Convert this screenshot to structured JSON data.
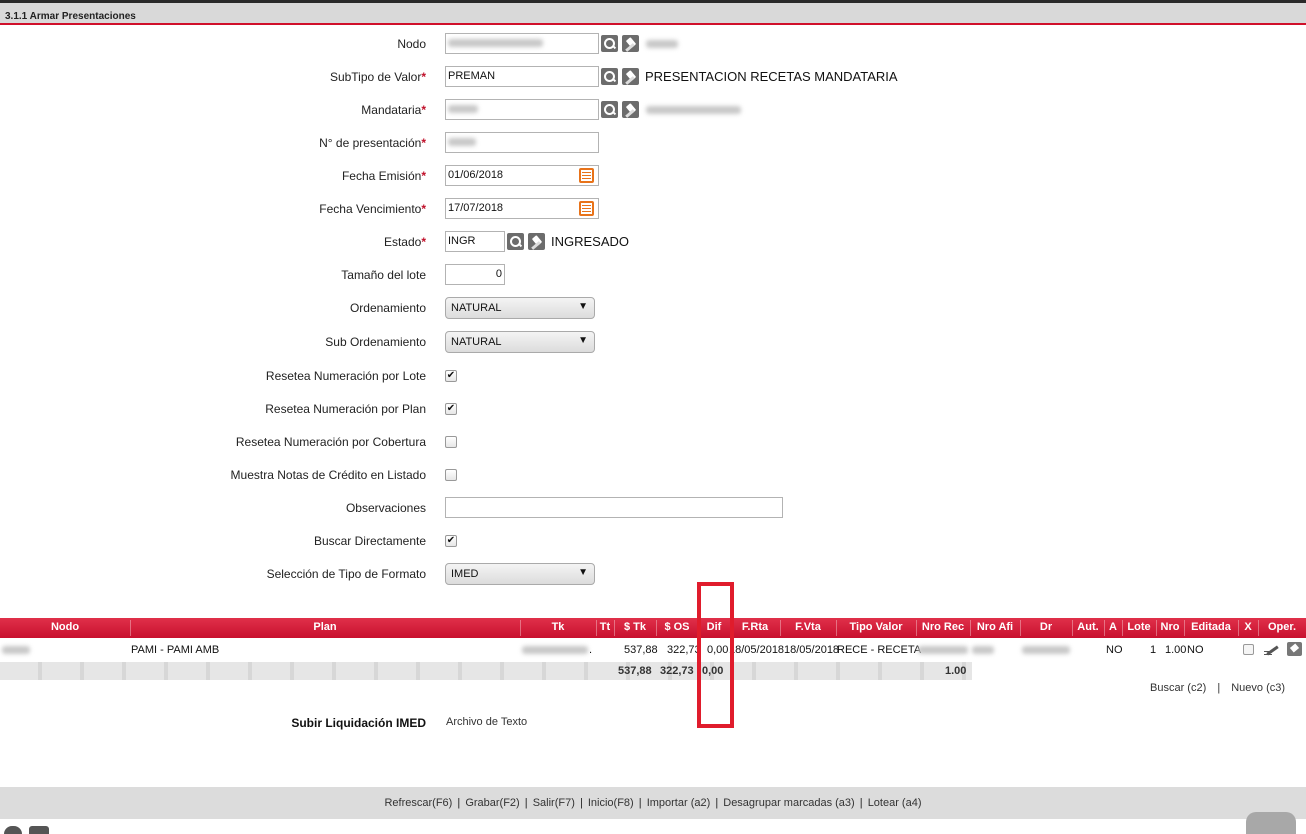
{
  "title": "3.1.1 Armar Presentaciones",
  "form": {
    "nodo": {
      "label": "Nodo",
      "value": "",
      "desc": ""
    },
    "subtipo": {
      "label": "SubTipo de Valor",
      "value": "PREMAN",
      "desc": "PRESENTACION RECETAS MANDATARIA"
    },
    "mandataria": {
      "label": "Mandataria",
      "value": "",
      "desc": ""
    },
    "presentacion": {
      "label": "N° de presentación",
      "value": ""
    },
    "fecha_emision": {
      "label": "Fecha Emisión",
      "value": "01/06/2018"
    },
    "fecha_vencimiento": {
      "label": "Fecha Vencimiento",
      "value": "17/07/2018"
    },
    "estado": {
      "label": "Estado",
      "value": "INGR",
      "desc": "INGRESADO"
    },
    "tamano_lote": {
      "label": "Tamaño del lote",
      "value": "0"
    },
    "ordenamiento": {
      "label": "Ordenamiento",
      "value": "NATURAL"
    },
    "sub_ordenamiento": {
      "label": "Sub Ordenamiento",
      "value": "NATURAL"
    },
    "resetea_lote": {
      "label": "Resetea Numeración por Lote",
      "checked": true
    },
    "resetea_plan": {
      "label": "Resetea Numeración por Plan",
      "checked": true
    },
    "resetea_cobertura": {
      "label": "Resetea Numeración por Cobertura",
      "checked": false
    },
    "notas_credito": {
      "label": "Muestra Notas de Crédito en Listado",
      "checked": false
    },
    "observaciones": {
      "label": "Observaciones",
      "value": ""
    },
    "buscar_directamente": {
      "label": "Buscar Directamente",
      "checked": true
    },
    "tipo_formato": {
      "label": "Selección de Tipo de Formato",
      "value": "IMED"
    },
    "check_mark": "✔",
    "dropdown_arrow": "▼"
  },
  "grid": {
    "headers": [
      "Nodo",
      "Plan",
      "Tk",
      "Tt",
      "$ Tk",
      "$ OS",
      "Dif",
      "F.Rta",
      "F.Vta",
      "Tipo Valor",
      "Nro Rec",
      "Nro Afi",
      "Dr",
      "Aut.",
      "A",
      "Lote",
      "Nro",
      "Editada",
      "X",
      "Oper."
    ],
    "row": {
      "plan": "PAMI - PAMI AMB",
      "tk_suffix": ".",
      "stk": "537,88",
      "sos": "322,73",
      "dif": "0,00",
      "frta": "18/05/2018",
      "fvta": "18/05/2018",
      "tipo_valor": "RECE - RECETA",
      "aut": "NO",
      "lote": "1",
      "nro": "1.00",
      "editada": "NO"
    },
    "totals": {
      "stk": "537,88",
      "sos": "322,73",
      "dif": "0,00",
      "nro_rec": "1.00"
    }
  },
  "actions": {
    "buscar": "Buscar (c2)",
    "sep": "|",
    "nuevo": "Nuevo (c3)"
  },
  "subir": {
    "label": "Subir Liquidación IMED",
    "value": "Archivo de Texto"
  },
  "footer": {
    "refrescar": "Refrescar(F6)",
    "grabar": "Grabar(F2)",
    "salir": "Salir(F7)",
    "inicio": "Inicio(F8)",
    "importar": "Importar (a2)",
    "desagrupar": "Desagrupar marcadas (a3)",
    "lotear": "Lotear (a4)",
    "sep": "|"
  },
  "colors": {
    "accent": "#c8102e",
    "highlight": "#e01c2c",
    "calendar": "#e8731a"
  }
}
